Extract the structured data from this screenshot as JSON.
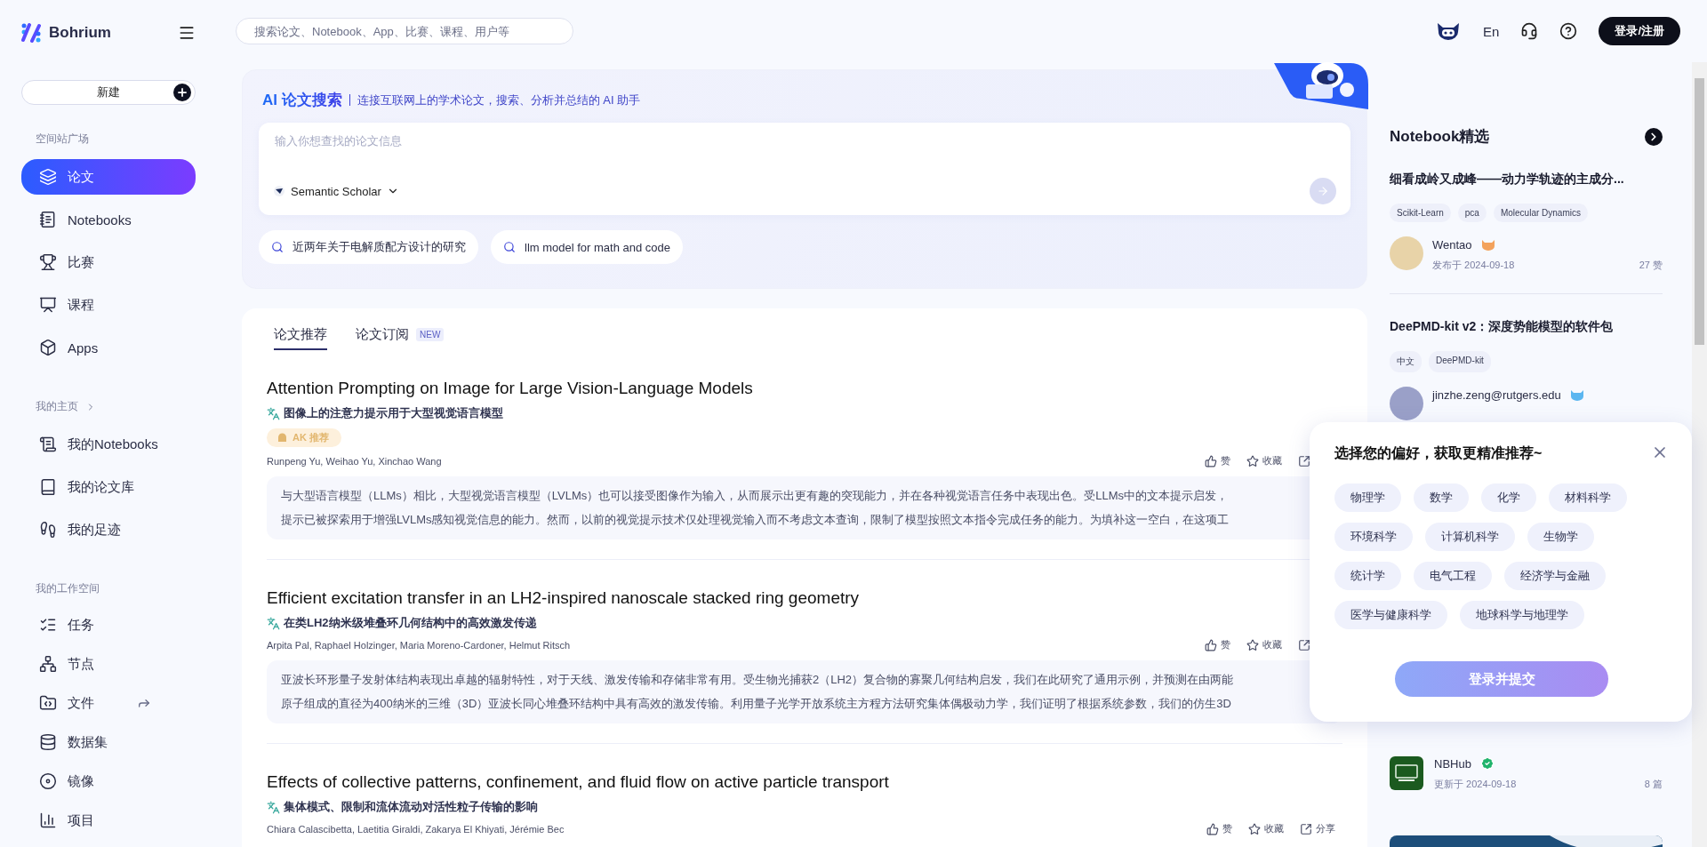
{
  "brand": {
    "name": "Bohrium"
  },
  "search": {
    "placeholder": "搜索论文、Notebook、App、比赛、课程、用户等"
  },
  "header": {
    "language": "En",
    "login_button": "登录/注册"
  },
  "sidebar": {
    "new_button": "新建",
    "sections": [
      {
        "title": "空间站广场",
        "items": [
          {
            "label": "论文",
            "selected": true,
            "kind": "plain"
          },
          {
            "label": "Notebooks",
            "selected": false,
            "kind": "plain"
          },
          {
            "label": "比赛",
            "selected": false,
            "kind": "plain"
          },
          {
            "label": "课程",
            "selected": false,
            "kind": "plain"
          },
          {
            "label": "Apps",
            "selected": false,
            "kind": "plain"
          }
        ]
      },
      {
        "title": "我的主页",
        "items": [
          {
            "label": "我的Notebooks",
            "selected": false,
            "kind": "plain"
          },
          {
            "label": "我的论文库",
            "selected": false,
            "kind": "plain"
          },
          {
            "label": "我的足迹",
            "selected": false,
            "kind": "plain"
          }
        ]
      },
      {
        "title": "我的工作空间",
        "items": [
          {
            "label": "任务",
            "selected": false,
            "kind": "plain"
          },
          {
            "label": "节点",
            "selected": false,
            "kind": "plain"
          },
          {
            "label": "文件",
            "selected": false,
            "kind": "shortcut"
          },
          {
            "label": "数据集",
            "selected": false,
            "kind": "plain"
          },
          {
            "label": "镜像",
            "selected": false,
            "kind": "plain"
          },
          {
            "label": "项目",
            "selected": false,
            "kind": "plain"
          }
        ]
      }
    ]
  },
  "ai_search": {
    "title": "AI 论文搜索",
    "subtitle": "连接互联网上的学术论文，搜索、分析并总结的 AI 助手",
    "input": {
      "placeholder": "输入你想查找的论文信息"
    },
    "source": "Semantic Scholar",
    "send_disabled": true,
    "suggestions": [
      "近两年关于电解质配方设计的研究",
      "llm model for math and code"
    ]
  },
  "tabs": [
    {
      "label": "论文推荐",
      "selected": true
    },
    {
      "label": "论文订阅",
      "selected": false,
      "badge": "NEW"
    }
  ],
  "papers": [
    {
      "title": "Attention Prompting on Image for Large Vision-Language Models",
      "translation": "图像上的注意力提示用于大型视觉语言模型",
      "badge": "AK 推荐",
      "authors": "Runpeng Yu, Weihao Yu, Xinchao Wang",
      "actions": [
        {
          "kind": "like",
          "label": "赞"
        },
        {
          "kind": "favorite",
          "label": "收藏"
        },
        {
          "kind": "share"
        }
      ],
      "abstract": [
        "与大型语言模型（LLMs）相比，大型视觉语言模型（LVLMs）也可以接受图像作为输入，从而展示出更有趣的突现能力，并在各种视觉语言任务中表现出色。受LLMs中的文本提示启发，",
        "提示已被探索用于增强LVLMs感知视觉信息的能力。然而，以前的视觉提示技术仅处理视觉输入而不考虑文本查询，限制了模型按照文本指令完成任务的能力。为填补这一空白，在这项工"
      ]
    },
    {
      "title": "Efficient excitation transfer in an LH2-inspired nanoscale stacked ring geometry",
      "translation": "在类LH2纳米级堆叠环几何结构中的高效激发传递",
      "authors": "Arpita Pal, Raphael Holzinger, Maria Moreno-Cardoner, Helmut Ritsch",
      "actions": [
        {
          "kind": "like",
          "label": "赞"
        },
        {
          "kind": "favorite",
          "label": "收藏"
        },
        {
          "kind": "share"
        }
      ],
      "abstract": [
        "亚波长环形量子发射体结构表现出卓越的辐射特性，对于天线、激发传输和存储非常有用。受生物光捕获2（LH2）复合物的寡聚几何结构启发，我们在此研究了通用示例，并预测在由两能",
        "原子组成的直径为400纳米的三维（3D）亚波长同心堆叠环结构中具有高效的激发传输。利用量子光学开放系统主方程方法研究集体偶极动力学，我们证明了根据系统参数，我们的仿生3D"
      ]
    },
    {
      "title": "Effects of collective patterns, confinement, and fluid flow on active particle transport",
      "translation": "集体模式、限制和流体流动对活性粒子传输的影响",
      "authors": "Chiara Calascibetta, Laetitia Giraldi, Zakarya El Khiyati, Jérémie Bec",
      "actions": [
        {
          "kind": "like",
          "label": "赞"
        },
        {
          "kind": "favorite",
          "label": "收藏"
        },
        {
          "kind": "share",
          "label": "分享"
        }
      ]
    }
  ],
  "right_panel": {
    "title": "Notebook精选",
    "notebooks": [
      {
        "title": "细看成岭又成峰——动力学轨迹的主成分...",
        "tags": [
          "Scikit-Learn",
          "pca",
          "Molecular Dynamics"
        ],
        "author": "Wentao",
        "date": "发布于 2024-09-18",
        "likes": "27 赞"
      },
      {
        "title": "DeePMD-kit v2：深度势能模型的软件包",
        "tags": [
          "中文",
          "DeePMD-kit"
        ],
        "author": "jinzhe.zeng@rutgers.edu"
      }
    ],
    "collection": {
      "name": "NBHub",
      "date": "更新于 2024-09-18",
      "count": "8 篇"
    }
  },
  "preferences": {
    "title": "选择您的偏好，获取更精准推荐~",
    "options": [
      {
        "label": "物理学",
        "selected": false
      },
      {
        "label": "数学",
        "selected": false
      },
      {
        "label": "化学",
        "selected": false
      },
      {
        "label": "材料科学",
        "selected": false
      },
      {
        "label": "环境科学",
        "selected": false
      },
      {
        "label": "计算机科学",
        "selected": false
      },
      {
        "label": "生物学",
        "selected": false
      },
      {
        "label": "统计学",
        "selected": false
      },
      {
        "label": "电气工程",
        "selected": false
      },
      {
        "label": "经济学与金融",
        "selected": false
      },
      {
        "label": "医学与健康科学",
        "selected": false
      },
      {
        "label": "地球科学与地理学",
        "selected": false
      }
    ],
    "submit": "登录并提交",
    "submit_disabled": true
  }
}
